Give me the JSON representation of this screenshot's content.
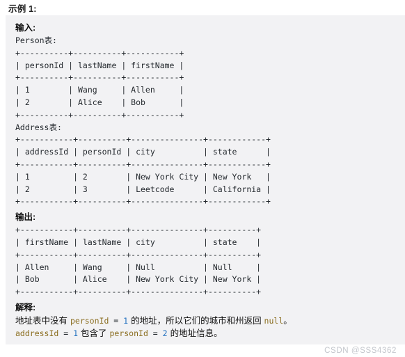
{
  "page": {
    "title": "示例 1:",
    "panel_bg": "#f2f2f4",
    "watermark": "CSDN @SSS4362"
  },
  "input_section": {
    "label": "输入:",
    "person_caption": "Person表:",
    "person_table": "+----------+----------+-----------+\n| personId | lastName | firstName |\n+----------+----------+-----------+\n| 1        | Wang     | Allen     |\n| 2        | Alice    | Bob       |\n+----------+----------+-----------+",
    "address_caption": "Address表:",
    "address_table": "+-----------+----------+---------------+------------+\n| addressId | personId | city          | state      |\n+-----------+----------+---------------+------------+\n| 1         | 2        | New York City | New York   |\n| 2         | 3        | Leetcode      | California |\n+-----------+----------+---------------+------------+"
  },
  "output_section": {
    "label": "输出:",
    "result_table": "+-----------+----------+---------------+----------+\n| firstName | lastName | city          | state    |\n+-----------+----------+---------------+----------+\n| Allen     | Wang     | Null          | Null     |\n| Bob       | Alice    | New York City | New York |\n+-----------+----------+---------------+----------+"
  },
  "explain_section": {
    "label": "解释:",
    "line1_a": "地址表中没有 ",
    "line1_id": "personId",
    "line1_eq": " = ",
    "line1_num": "1",
    "line1_b": " 的地址，所以它们的城市和州返回 ",
    "line1_null": "null",
    "line1_c": "。",
    "line2_id1": "addressId",
    "line2_eq1": " = ",
    "line2_num1": "1",
    "line2_mid": " 包含了 ",
    "line2_id2": "personId",
    "line2_eq2": " = ",
    "line2_num2": "2",
    "line2_end": " 的地址信息。"
  },
  "colors": {
    "identifier": "#8a6d1f",
    "number": "#1f6fbf",
    "text": "#24292e",
    "panel": "#f2f2f4",
    "watermark": "#c3c6cc"
  },
  "tables_data": {
    "person": {
      "columns": [
        "personId",
        "lastName",
        "firstName"
      ],
      "rows": [
        [
          "1",
          "Wang",
          "Allen"
        ],
        [
          "2",
          "Alice",
          "Bob"
        ]
      ]
    },
    "address": {
      "columns": [
        "addressId",
        "personId",
        "city",
        "state"
      ],
      "rows": [
        [
          "1",
          "2",
          "New York City",
          "New York"
        ],
        [
          "2",
          "3",
          "Leetcode",
          "California"
        ]
      ]
    },
    "output": {
      "columns": [
        "firstName",
        "lastName",
        "city",
        "state"
      ],
      "rows": [
        [
          "Allen",
          "Wang",
          "Null",
          "Null"
        ],
        [
          "Bob",
          "Alice",
          "New York City",
          "New York"
        ]
      ]
    }
  }
}
